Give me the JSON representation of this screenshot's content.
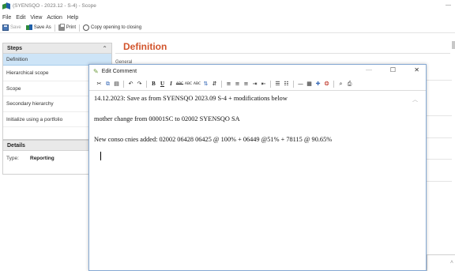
{
  "window": {
    "title": "(SYENSQO - 2023.12 - S-4) - Scope",
    "minimize": "—"
  },
  "menu": [
    "File",
    "Edit",
    "View",
    "Action",
    "Help"
  ],
  "toolbar": {
    "save": "Save",
    "save_as": "Save As",
    "print": "Print",
    "copy_opening": "Copy opening to closing"
  },
  "steps": {
    "header": "Steps",
    "collapse_icon": "⌃",
    "items": [
      {
        "label": "Definition",
        "selected": true
      },
      {
        "label": "Hierarchical scope",
        "selected": false
      },
      {
        "label": "Scope",
        "selected": false
      },
      {
        "label": "Secondary hierarchy",
        "selected": false
      },
      {
        "label": "Initialize using a portfolio",
        "selected": false
      }
    ]
  },
  "details": {
    "header": "Details",
    "type_label": "Type:",
    "type_value": "Reporting"
  },
  "definition": {
    "title": "Definition",
    "general_label": "General"
  },
  "dialog": {
    "title": "Edit Comment",
    "minimize": "—",
    "maximize": "☐",
    "close": "✕",
    "toolbar": [
      "cut-icon",
      "copy-icon",
      "paste-icon",
      "undo-icon",
      "redo-icon",
      "bold-icon",
      "underline-icon",
      "italic-icon",
      "strikethrough-icon",
      "superscript-icon",
      "subscript-icon",
      "sort-asc-icon",
      "sort-desc-icon",
      "align-left-icon",
      "align-center-icon",
      "align-right-icon",
      "indent-icon",
      "outdent-icon",
      "bullets-icon",
      "numbering-icon",
      "horizontal-line-icon",
      "table-icon",
      "insert-icon",
      "image-icon",
      "find-icon",
      "print-icon"
    ],
    "lines": [
      "14.12.2023: Save as from SYENSQO 2023.09 S-4 + modifications below",
      "mother change from 00001SC to 02002 SYENSQO SA",
      "New conso cnies added: 02002 06428 06425 @ 100% +  06449 @51% + 78115 @ 90.65%"
    ]
  },
  "colors": {
    "accent_title": "#d2542c",
    "selection": "#cde4f7",
    "dialog_border": "#86a9d3"
  }
}
